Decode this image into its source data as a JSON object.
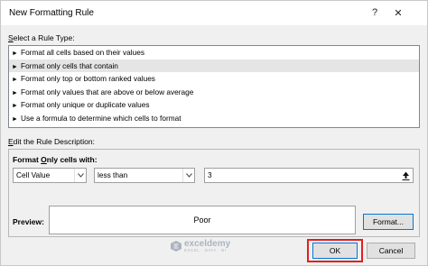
{
  "window": {
    "title": "New Formatting Rule",
    "help_glyph": "?",
    "close_glyph": "✕"
  },
  "rule_type": {
    "label_first": "S",
    "label_rest": "elect a Rule Type:",
    "items": [
      {
        "label": "Format all cells based on their values",
        "selected": false
      },
      {
        "label": "Format only cells that contain",
        "selected": true
      },
      {
        "label": "Format only top or bottom ranked values",
        "selected": false
      },
      {
        "label": "Format only values that are above or below average",
        "selected": false
      },
      {
        "label": "Format only unique or duplicate values",
        "selected": false
      },
      {
        "label": "Use a formula to determine which cells to format",
        "selected": false
      }
    ],
    "bullet_glyph": "►"
  },
  "description": {
    "label_first": "E",
    "label_rest": "dit the Rule Description:",
    "format_only_label_first": "O",
    "format_only_label_rest": "nly cells with:",
    "format_only_prefix": "Format ",
    "condition_field": "Cell Value",
    "operator": "less than",
    "value": "3",
    "preview_label": "Preview:",
    "preview_text": "Poor",
    "format_button": "Format..."
  },
  "footer": {
    "ok": "OK",
    "cancel": "Cancel"
  },
  "watermark": {
    "name": "exceldemy",
    "tagline": "EXCEL · DATA · BI"
  },
  "colors": {
    "ok_highlight": "#e02020",
    "focus_border": "#0078d7"
  }
}
